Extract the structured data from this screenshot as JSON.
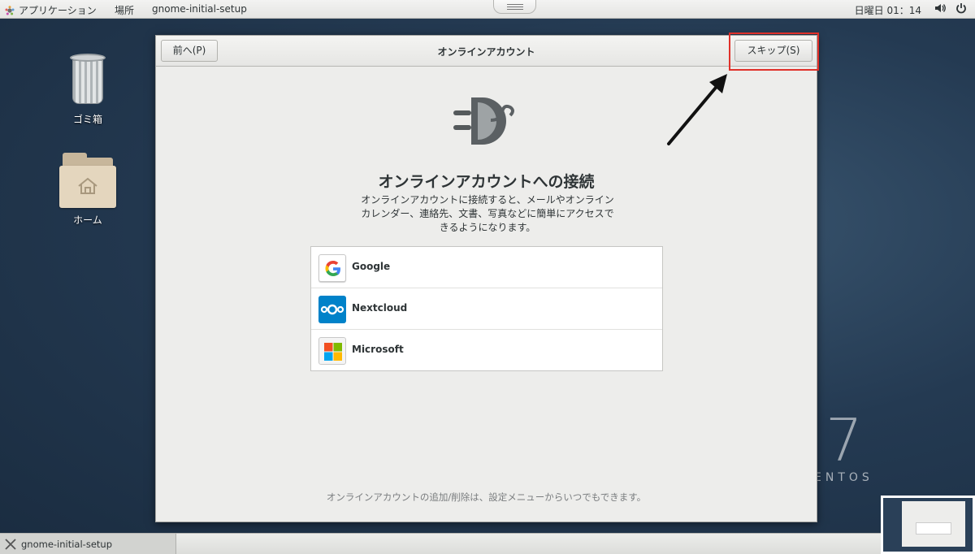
{
  "topbar": {
    "applications": "アプリケーション",
    "places": "場所",
    "app_name": "gnome-initial-setup",
    "clock": "日曜日 01：14"
  },
  "desktop": {
    "trash_label": "ゴミ箱",
    "home_label": "ホーム",
    "wallpaper_number": "7",
    "wallpaper_text": "ENTOS"
  },
  "dialog": {
    "back_button": "前へ(P)",
    "title": "オンラインアカウント",
    "skip_button": "スキップ(S)",
    "heading": "オンラインアカウントへの接続",
    "description": "オンラインアカウントに接続すると、メールやオンラインカレンダー、連絡先、文書、写真などに簡単にアクセスできるようになります。",
    "providers": [
      {
        "name": "Google",
        "icon": "google-icon"
      },
      {
        "name": "Nextcloud",
        "icon": "nextcloud-icon"
      },
      {
        "name": "Microsoft",
        "icon": "microsoft-icon"
      }
    ],
    "footer_note": "オンラインアカウントの追加/削除は、設定メニューからいつでもできます。"
  },
  "taskbar": {
    "window_item": "gnome-initial-setup"
  },
  "colors": {
    "highlight": "#e0312a",
    "nextcloud_blue": "#0082c9"
  }
}
